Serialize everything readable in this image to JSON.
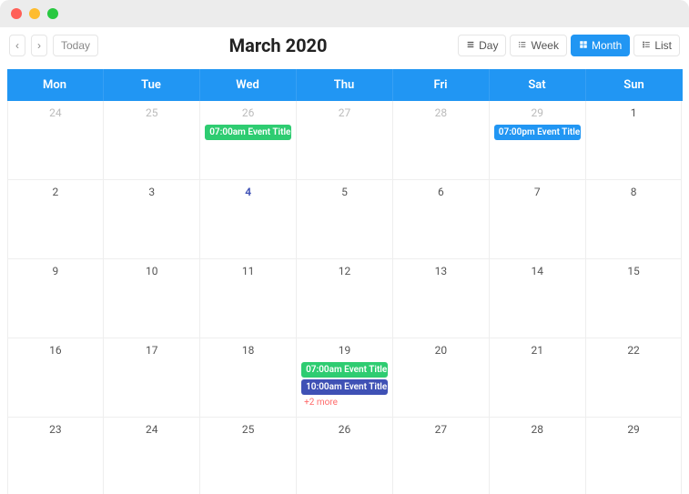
{
  "window": {
    "close": "close",
    "min": "minimize",
    "max": "maximize"
  },
  "toolbar": {
    "prev": "‹",
    "next": "›",
    "today": "Today",
    "title": "March 2020",
    "views": {
      "day": "Day",
      "week": "Week",
      "month": "Month",
      "list": "List"
    },
    "active_view": "month"
  },
  "calendar": {
    "daynames": [
      "Mon",
      "Tue",
      "Wed",
      "Thu",
      "Fri",
      "Sat",
      "Sun"
    ],
    "weeks": [
      [
        {
          "d": "24",
          "other": true
        },
        {
          "d": "25",
          "other": true
        },
        {
          "d": "26",
          "other": true,
          "events": [
            {
              "time": "07:00am",
              "title": "Event Title F",
              "color": "green"
            }
          ]
        },
        {
          "d": "27",
          "other": true
        },
        {
          "d": "28",
          "other": true
        },
        {
          "d": "29",
          "other": true,
          "events": [
            {
              "time": "07:00pm",
              "title": "Event Title F",
              "color": "blue"
            }
          ]
        },
        {
          "d": "1"
        }
      ],
      [
        {
          "d": "2"
        },
        {
          "d": "3"
        },
        {
          "d": "4",
          "today": true
        },
        {
          "d": "5"
        },
        {
          "d": "6"
        },
        {
          "d": "7"
        },
        {
          "d": "8"
        }
      ],
      [
        {
          "d": "9"
        },
        {
          "d": "10"
        },
        {
          "d": "11"
        },
        {
          "d": "12"
        },
        {
          "d": "13"
        },
        {
          "d": "14"
        },
        {
          "d": "15"
        }
      ],
      [
        {
          "d": "16"
        },
        {
          "d": "17"
        },
        {
          "d": "18"
        },
        {
          "d": "19",
          "events": [
            {
              "time": "07:00am",
              "title": "Event Title N",
              "color": "green"
            },
            {
              "time": "10:00am",
              "title": "Event Title M",
              "color": "indigo"
            }
          ],
          "more": "+2 more"
        },
        {
          "d": "20"
        },
        {
          "d": "21"
        },
        {
          "d": "22"
        }
      ],
      [
        {
          "d": "23"
        },
        {
          "d": "24"
        },
        {
          "d": "25"
        },
        {
          "d": "26"
        },
        {
          "d": "27"
        },
        {
          "d": "28"
        },
        {
          "d": "29"
        }
      ]
    ]
  }
}
